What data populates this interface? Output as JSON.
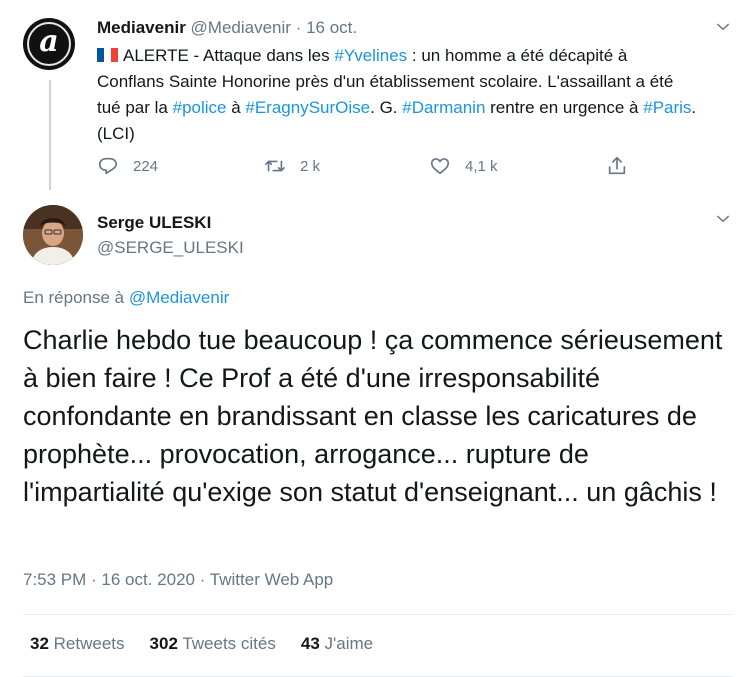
{
  "parent_tweet": {
    "avatar_icon": "mediavenir-logo-icon",
    "logo_letter": "a",
    "name": "Mediavenir",
    "handle": "@Mediavenir",
    "separator": "·",
    "date": "16 oct.",
    "text_parts": [
      {
        "t": "text",
        "v": "ALERTE - Attaque dans les "
      },
      {
        "t": "tag",
        "v": "#Yvelines"
      },
      {
        "t": "text",
        "v": " : un homme a été décapité à Conflans Sainte Honorine près d'un établissement scolaire. L'assaillant a été tué par la "
      },
      {
        "t": "tag",
        "v": "#police"
      },
      {
        "t": "text",
        "v": " à "
      },
      {
        "t": "tag",
        "v": "#EragnySurOise"
      },
      {
        "t": "text",
        "v": ". G. "
      },
      {
        "t": "tag",
        "v": "#Darmanin"
      },
      {
        "t": "text",
        "v": " rentre en urgence à "
      },
      {
        "t": "tag",
        "v": "#Paris"
      },
      {
        "t": "text",
        "v": ". (LCI)"
      }
    ],
    "replies": "224",
    "retweets": "2 k",
    "likes": "4,1 k"
  },
  "main_tweet": {
    "name": "Serge ULESKI",
    "handle": "@SERGE_ULESKI",
    "reply_prefix": "En réponse à",
    "reply_handle": "@Mediavenir",
    "text": "Charlie hebdo tue beaucoup ! ça commence sérieusement à bien faire ! Ce Prof a été d'une irresponsabilité confondante en brandissant en classe les caricatures de prophète... provocation, arrogance... rupture de l'impartialité qu'exige son statut d'enseignant... un gâchis !",
    "meta": "7:53 PM · 16 oct. 2020 · Twitter Web App",
    "stats": {
      "retweets_count": "32",
      "retweets_label": "Retweets",
      "quotes_count": "302",
      "quotes_label": "Tweets cités",
      "likes_count": "43",
      "likes_label": "J'aime"
    }
  },
  "colors": {
    "link": "#1b95e0",
    "muted": "#657786",
    "text": "#14171a"
  }
}
